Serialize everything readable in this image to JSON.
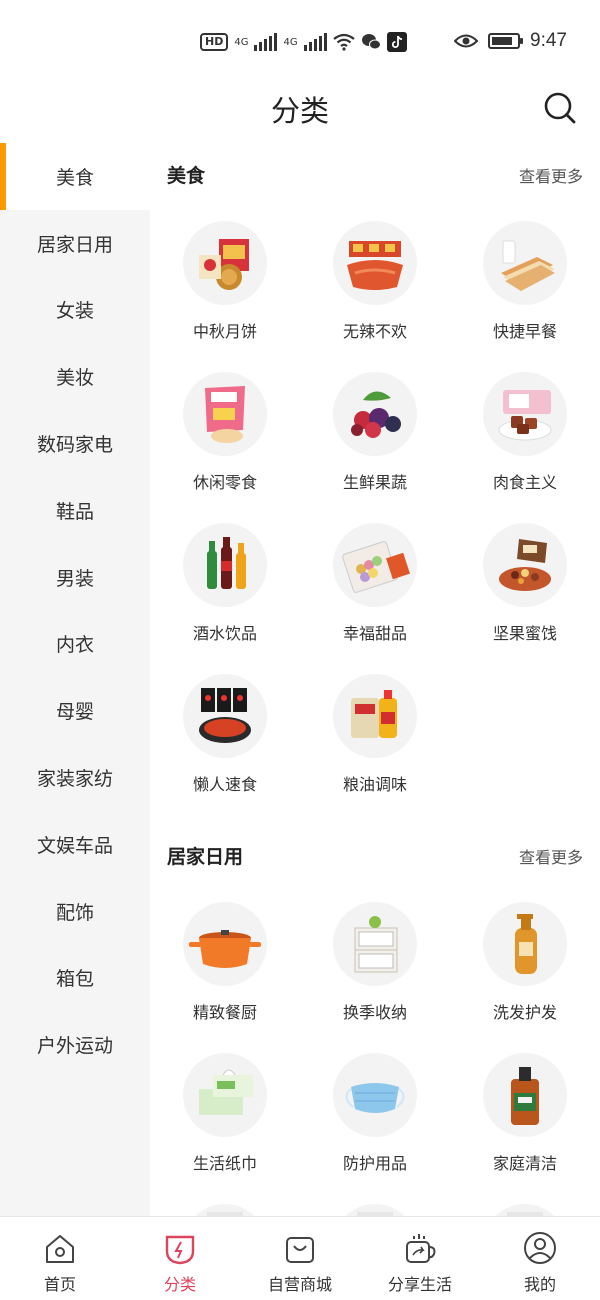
{
  "status_bar": {
    "hd_chip": "HD",
    "sim1": "4G",
    "sim2": "4G",
    "time": "9:47",
    "battery_level": 0.85
  },
  "header": {
    "title": "分类",
    "search_icon": "search-icon"
  },
  "sidebar": {
    "items": [
      {
        "label": "美食",
        "active": true
      },
      {
        "label": "居家日用"
      },
      {
        "label": "女装"
      },
      {
        "label": "美妆"
      },
      {
        "label": "数码家电"
      },
      {
        "label": "鞋品"
      },
      {
        "label": "男装"
      },
      {
        "label": "内衣"
      },
      {
        "label": "母婴"
      },
      {
        "label": "家装家纺"
      },
      {
        "label": "文娱车品"
      },
      {
        "label": "配饰"
      },
      {
        "label": "箱包"
      },
      {
        "label": "户外运动"
      }
    ]
  },
  "sections": [
    {
      "title": "美食",
      "more": "查看更多",
      "items": [
        {
          "label": "中秋月饼",
          "icon": "mooncake-icon"
        },
        {
          "label": "无辣不欢",
          "icon": "spicy-snack-icon"
        },
        {
          "label": "快捷早餐",
          "icon": "bread-icon"
        },
        {
          "label": "休闲零食",
          "icon": "snack-bag-icon"
        },
        {
          "label": "生鲜果蔬",
          "icon": "berries-icon"
        },
        {
          "label": "肉食主义",
          "icon": "meat-icon"
        },
        {
          "label": "酒水饮品",
          "icon": "bottles-icon"
        },
        {
          "label": "幸福甜品",
          "icon": "macaron-icon"
        },
        {
          "label": "坚果蜜饯",
          "icon": "nuts-icon"
        },
        {
          "label": "懒人速食",
          "icon": "instant-noodle-icon"
        },
        {
          "label": "粮油调味",
          "icon": "rice-oil-icon"
        }
      ]
    },
    {
      "title": "居家日用",
      "more": "查看更多",
      "items": [
        {
          "label": "精致餐厨",
          "icon": "pot-icon"
        },
        {
          "label": "换季收纳",
          "icon": "storage-box-icon"
        },
        {
          "label": "洗发护发",
          "icon": "shampoo-icon"
        },
        {
          "label": "生活纸巾",
          "icon": "tissue-icon"
        },
        {
          "label": "防护用品",
          "icon": "mask-icon"
        },
        {
          "label": "家庭清洁",
          "icon": "disinfectant-icon"
        },
        {
          "label": "",
          "icon": "partial-item-icon"
        },
        {
          "label": "",
          "icon": "partial-item-icon"
        },
        {
          "label": "",
          "icon": "partial-item-icon"
        }
      ]
    }
  ],
  "tabbar": {
    "tabs": [
      {
        "label": "首页",
        "icon": "home-icon"
      },
      {
        "label": "分类",
        "icon": "category-icon",
        "active": true
      },
      {
        "label": "自营商城",
        "icon": "shopping-bag-icon"
      },
      {
        "label": "分享生活",
        "icon": "share-life-icon"
      },
      {
        "label": "我的",
        "icon": "profile-icon"
      }
    ]
  },
  "colors": {
    "accent_sidebar": "#ff9900",
    "tab_active": "#e0435e"
  }
}
